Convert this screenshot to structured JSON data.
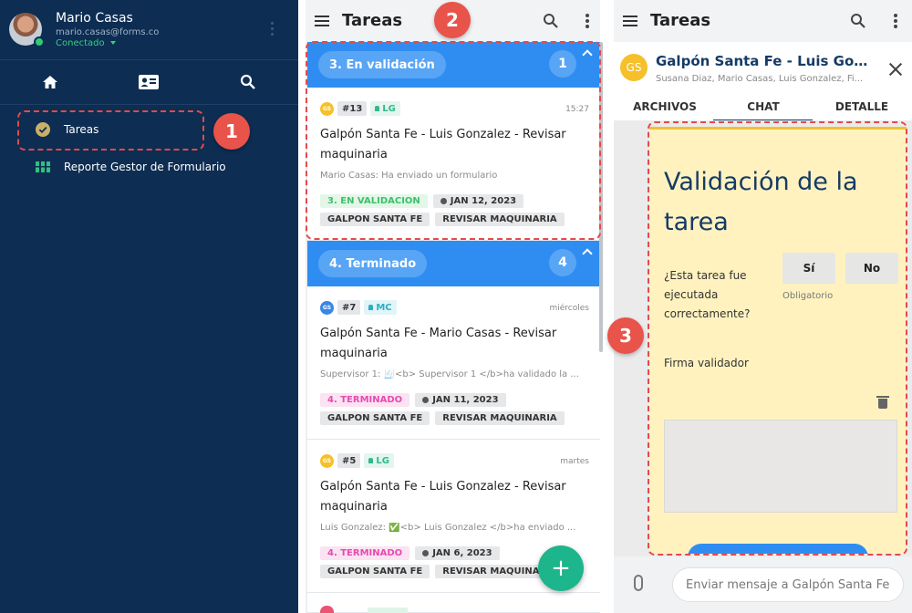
{
  "sidebar": {
    "user": {
      "name": "Mario Casas",
      "email": "mario.casas@forms.co",
      "status": "Conectado"
    },
    "items": [
      {
        "label": "Tareas"
      },
      {
        "label": "Reporte Gestor de Formulario"
      }
    ]
  },
  "list": {
    "title": "Tareas",
    "groups": [
      {
        "label": "3. En validación",
        "count": "1",
        "cards": [
          {
            "gs": "GS",
            "id": "#13",
            "user": "LG",
            "time": "15:27",
            "title": "Galpón Santa Fe - Luis Gonzalez - Revisar maquinaria",
            "sub": "Mario Casas: Ha enviado un formulario",
            "status": "3. EN VALIDACION",
            "date": "JAN 12, 2023",
            "tags": [
              "GALPON SANTA FE",
              "REVISAR MAQUINARIA"
            ]
          }
        ]
      },
      {
        "label": "4. Terminado",
        "count": "4",
        "cards": [
          {
            "gs": "GS",
            "id": "#7",
            "user": "MC",
            "time": "miércoles",
            "title": "Galpón Santa Fe - Mario Casas - Revisar maquinaria",
            "sub": "Supervisor 1: 🧾<b> Supervisor 1 </b>ha validado la ...",
            "status": "4. TERMINADO",
            "date": "JAN 11, 2023",
            "tags": [
              "GALPON SANTA FE",
              "REVISAR MAQUINARIA"
            ]
          },
          {
            "gs": "GS",
            "id": "#5",
            "user": "LG",
            "time": "martes",
            "title": "Galpón Santa Fe - Luis Gonzalez - Revisar maquinaria",
            "sub": "Luis Gonzalez: ✅<b> Luis Gonzalez </b>ha enviado ...",
            "status": "4. TERMINADO",
            "date": "JAN 6, 2023",
            "tags": [
              "GALPON SANTA FE",
              "REVISAR MAQUINARIA"
            ]
          }
        ]
      }
    ],
    "fab_label": "+"
  },
  "chat": {
    "appbar_title": "Tareas",
    "avatar": "GS",
    "title": "Galpón Santa Fe - Luis Gonzalez - Revisar maquinaria",
    "members": "Susana Diaz, Mario Casas, Luis Gonzalez, Fi...",
    "tabs": [
      "ARCHIVOS",
      "CHAT",
      "DETALLE"
    ],
    "form": {
      "title": "Validación de la tarea",
      "question": "¿Esta tarea fue ejecutada correctamente?",
      "yes": "Sí",
      "no": "No",
      "required": "Obligatorio",
      "signature_label": "Firma validador"
    },
    "input_placeholder": "Enviar mensaje a Galpón Santa Fe..."
  },
  "annotations": [
    "1",
    "2",
    "3"
  ],
  "colors": {
    "sidebar": "#0d2d52",
    "group_header": "#2f8df2",
    "fab": "#1db58b",
    "form_bg": "#fff2bf",
    "callout": "#e8534a"
  }
}
